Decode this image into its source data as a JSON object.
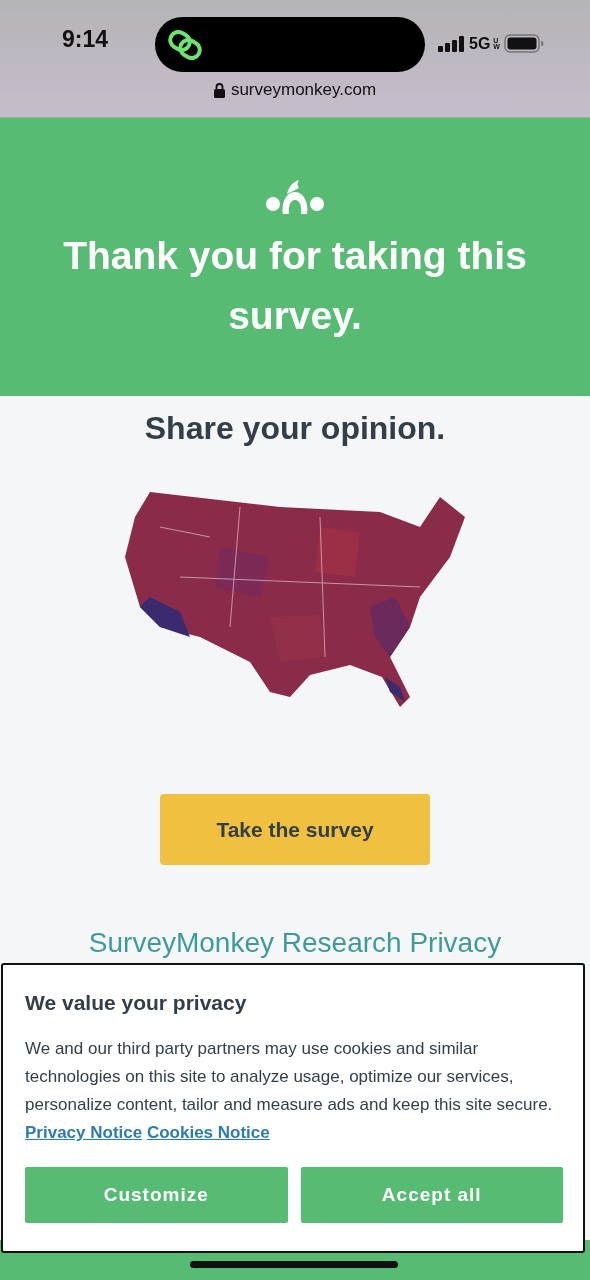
{
  "status_bar": {
    "time": "9:14",
    "network": "5G",
    "network_sub": "UW"
  },
  "address_bar": {
    "url": "surveymonkey.com"
  },
  "header": {
    "title": "Thank you for taking this survey."
  },
  "promo": {
    "heading": "Share your opinion.",
    "button": "Take the survey",
    "link": "SurveyMonkey Research Privacy"
  },
  "cookie_banner": {
    "title": "We value your privacy",
    "body": "We and our third party partners may use cookies and similar technologies on this site to analyze usage, optimize our services, personalize content, tailor and measure ads and keep this site secure.",
    "links": [
      "Privacy Notice",
      "Cookies Notice"
    ],
    "buttons": [
      "Customize",
      "Accept all"
    ]
  }
}
